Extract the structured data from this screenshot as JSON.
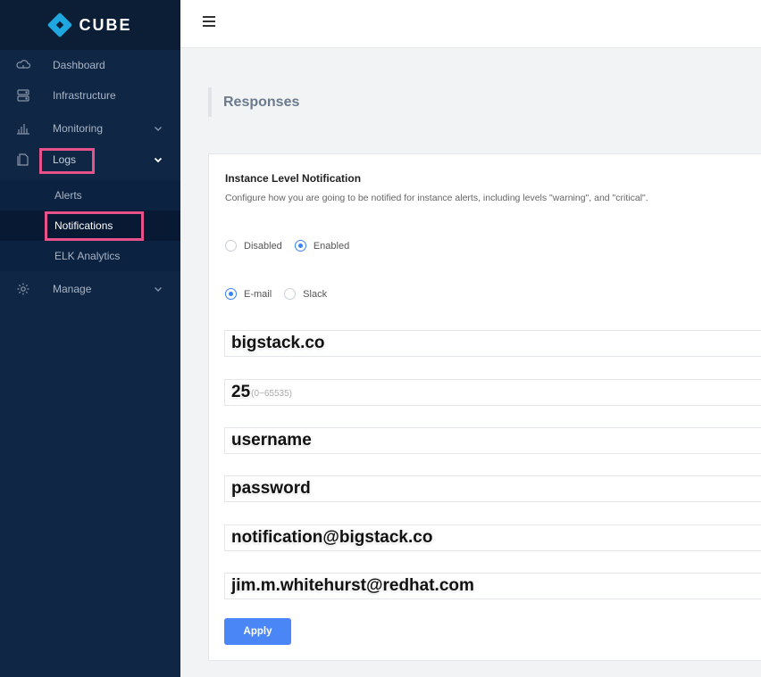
{
  "app": {
    "name": "CUBE"
  },
  "sidebar": {
    "items": [
      {
        "label": "Dashboard",
        "icon": "cloud-icon"
      },
      {
        "label": "Infrastructure",
        "icon": "server-icon"
      },
      {
        "label": "Monitoring",
        "icon": "bar-chart-icon",
        "chevron": "chevron-down-icon"
      },
      {
        "label": "Logs",
        "icon": "document-icon",
        "chevron": "chevron-up-icon",
        "expanded": true
      },
      {
        "label": "Manage",
        "icon": "gear-icon",
        "chevron": "chevron-down-icon"
      }
    ],
    "logs_submenu": [
      {
        "label": "Alerts"
      },
      {
        "label": "Notifications",
        "active": true
      },
      {
        "label": "ELK Analytics"
      }
    ]
  },
  "topbar": {
    "menu_icon": "hamburger-icon"
  },
  "page": {
    "title": "Responses"
  },
  "card": {
    "title": "Instance Level Notification",
    "description": "Configure how you are going to be notified for instance alerts, including levels \"warning\", and \"critical\".",
    "status_options": [
      {
        "label": "Disabled",
        "checked": false
      },
      {
        "label": "Enabled",
        "checked": true
      }
    ],
    "channel_options": [
      {
        "label": "E-mail",
        "checked": true
      },
      {
        "label": "Slack",
        "checked": false
      }
    ],
    "fields": {
      "smtp_host": "bigstack.co",
      "smtp_port": "25",
      "smtp_port_hint": "(0~65535)",
      "username": "username",
      "password": "password",
      "sender": "notification@bigstack.co",
      "recipient": "jim.m.whitehurst@redhat.com"
    },
    "apply_label": "Apply"
  },
  "colors": {
    "sidebar_bg": "#0f2745",
    "brand_bg": "#0b1e36",
    "accent": "#4a86f5",
    "highlight": "#e8528a",
    "logo": "#1fa8e0"
  }
}
